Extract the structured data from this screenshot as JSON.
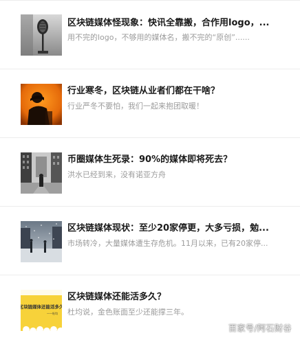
{
  "articles": [
    {
      "title": "区块链媒体怪现象：快讯全靠搬，合作用logo，...",
      "description": "用不完的logo，不够用的媒体名，搬不完的“原创”......",
      "thumbnail_icon": "microphone-photo"
    },
    {
      "title": "行业寒冬，区块链从业者们都在干啥？",
      "description": "行业严冬不要怕，我们一起来抱团取暖！",
      "thumbnail_icon": "person-orange-photo"
    },
    {
      "title": "币圈媒体生死录：90%的媒体即将死去？",
      "description": "洪水已经到来，没有诺亚方舟",
      "thumbnail_icon": "city-street-photo"
    },
    {
      "title": "区块链媒体现状：至少20家停更，大多亏损，勉...",
      "description": "市场转冷，大量媒体遭生存危机。11月以来，已有20家停...",
      "thumbnail_icon": "snowy-street-photo"
    },
    {
      "title": "区块链媒体还能活多久？",
      "description": "杜均说，金色账面至少还能撑三年。",
      "thumbnail_icon": "yellow-poster",
      "thumbnail_text": "区块链媒体还能活多久",
      "thumbnail_subtext": "——杜均"
    }
  ],
  "watermark": "百家号/阿石财谷",
  "colors": {
    "title": "#1a1a1a",
    "description": "#9b9b9b",
    "divider": "#ececec",
    "poster_yellow": "#f7d23a"
  }
}
